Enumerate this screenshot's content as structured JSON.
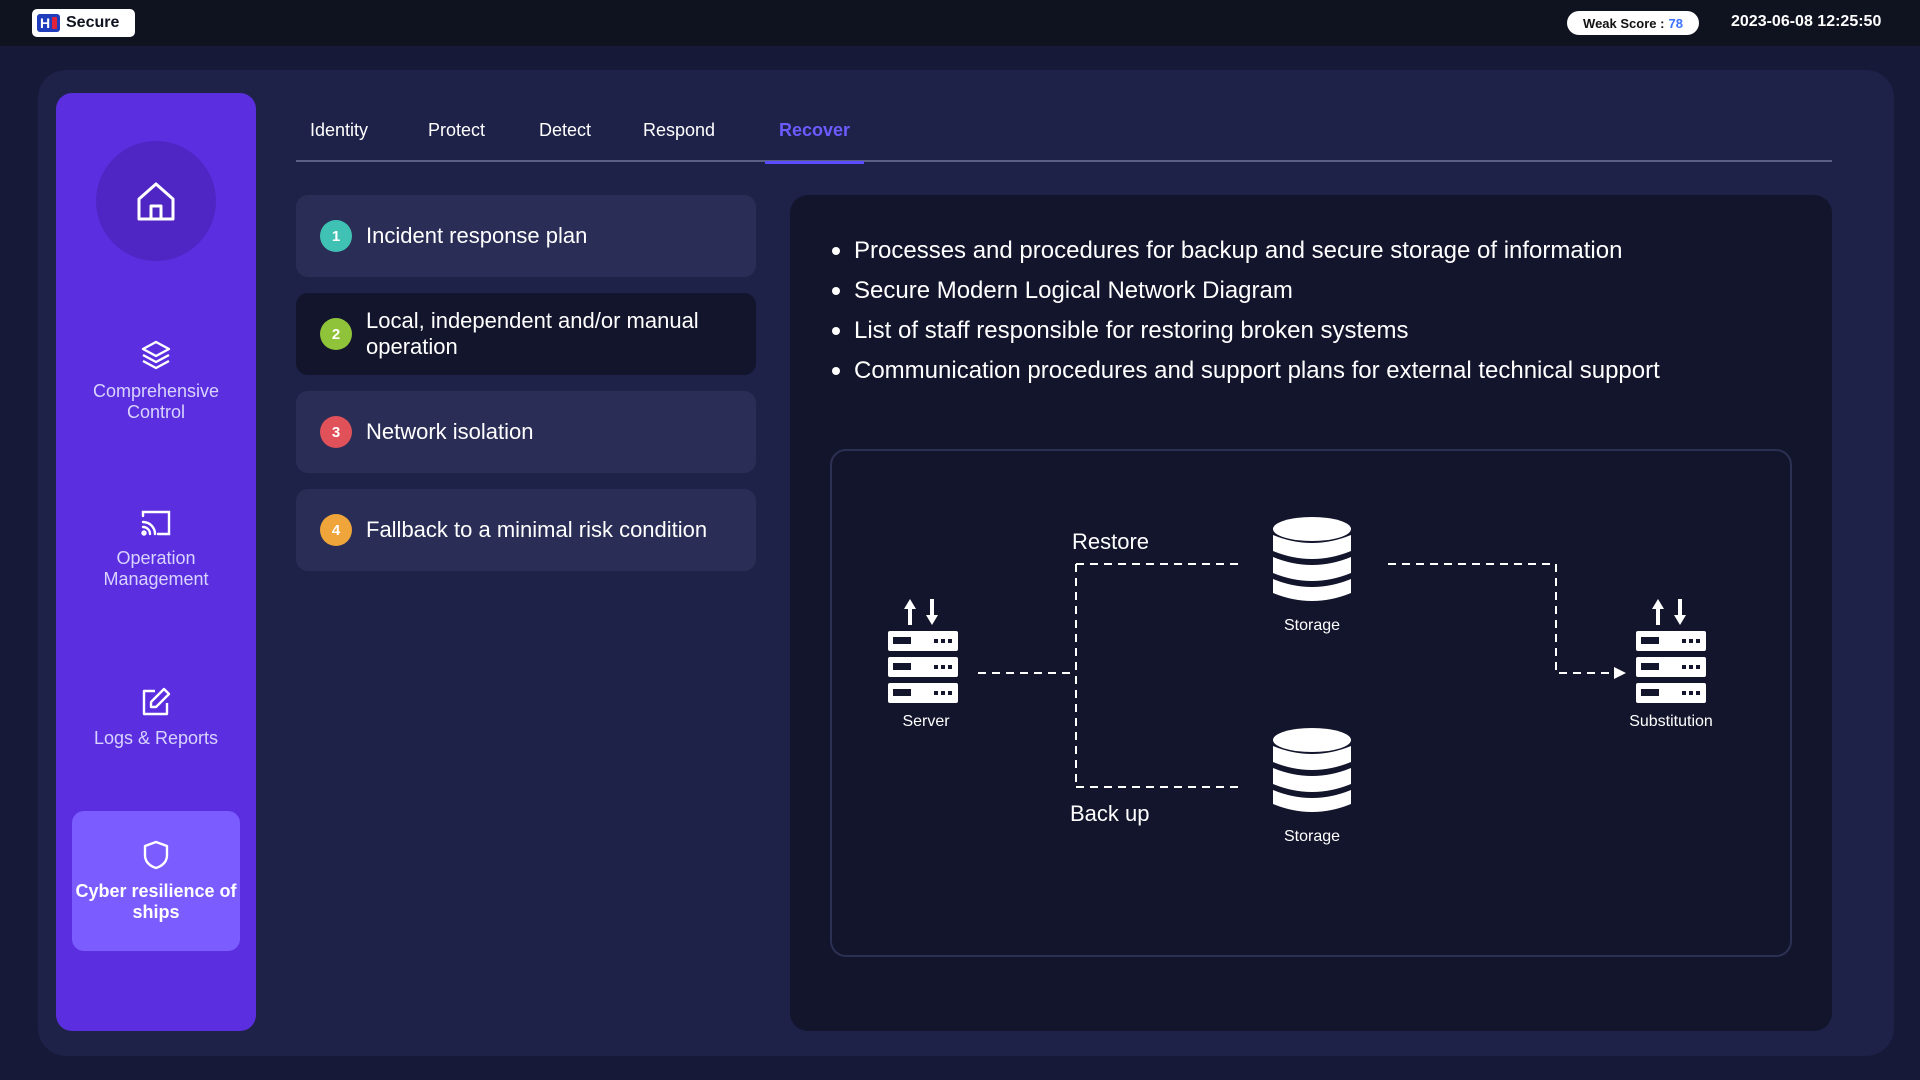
{
  "app": {
    "brand": "Secure",
    "weak_score_label": "Weak Score :",
    "weak_score_value": "78",
    "datetime": "2023-06-08 12:25:50"
  },
  "sidebar": {
    "items": [
      {
        "label": "Comprehensive Control",
        "icon": "layers-icon"
      },
      {
        "label": "Operation Management",
        "icon": "cast-icon"
      },
      {
        "label": "Logs & Reports",
        "icon": "edit-icon"
      },
      {
        "label": "Cyber resilience of ships",
        "icon": "shield-icon",
        "active": true
      }
    ]
  },
  "tabs": [
    {
      "label": "Identity"
    },
    {
      "label": "Protect"
    },
    {
      "label": "Detect"
    },
    {
      "label": "Respond"
    },
    {
      "label": "Recover",
      "active": true
    }
  ],
  "steps": [
    {
      "num": "1",
      "label": "Incident response plan",
      "color": "#3fc2b4"
    },
    {
      "num": "2",
      "label": "Local, independent and/or manual operation",
      "color": "#8fc33a",
      "active": true
    },
    {
      "num": "3",
      "label": "Network isolation",
      "color": "#e0515a"
    },
    {
      "num": "4",
      "label": "Fallback to a minimal risk condition",
      "color": "#f0a53a"
    }
  ],
  "bullets": [
    "Processes and procedures for backup and secure storage of information",
    "Secure Modern Logical Network Diagram",
    "List of staff responsible for restoring broken systems",
    "Communication procedures and support plans for external technical support"
  ],
  "diagram": {
    "server": "Server",
    "storage_top": "Storage",
    "storage_bottom": "Storage",
    "substitution": "Substitution",
    "restore": "Restore",
    "backup": "Back up"
  },
  "colors": {
    "background": "#161a38",
    "sidebar": "#5b2fe0",
    "accent": "#6a5cff",
    "panel": "#12152b"
  }
}
